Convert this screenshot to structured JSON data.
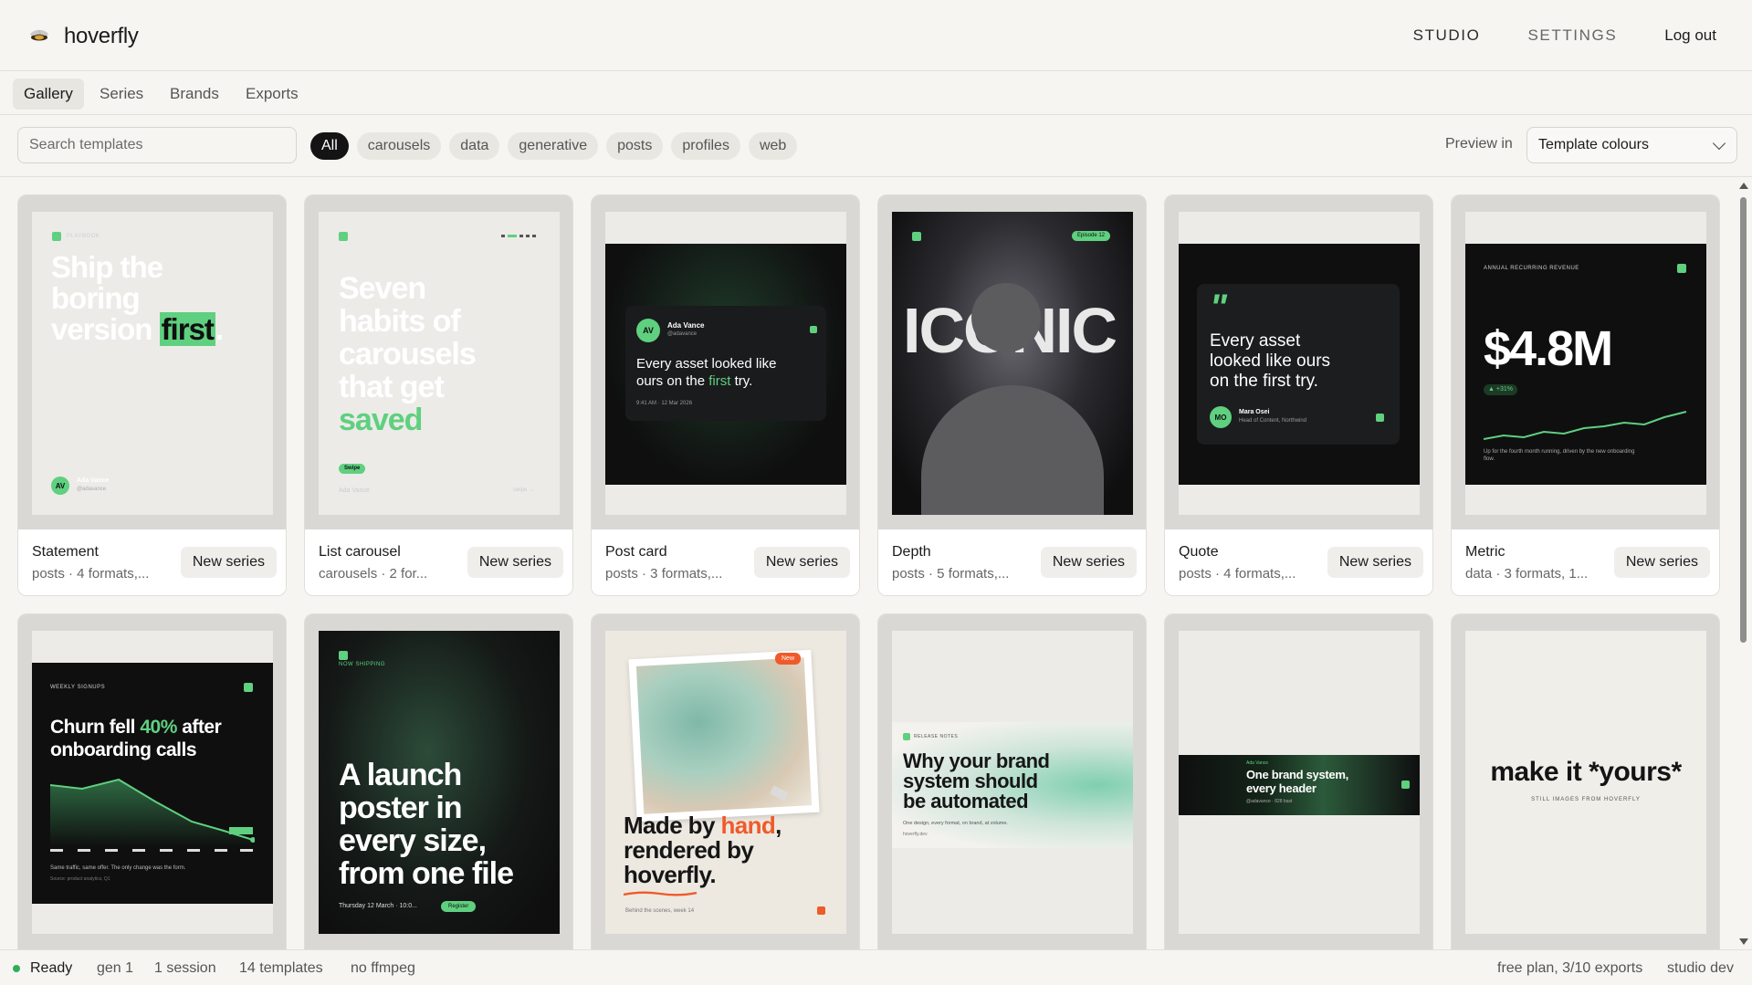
{
  "app": {
    "name": "hoverfly"
  },
  "topnav": {
    "studio": "STUDIO",
    "settings": "SETTINGS",
    "logout": "Log out"
  },
  "tabs": [
    "Gallery",
    "Series",
    "Brands",
    "Exports"
  ],
  "search": {
    "placeholder": "Search templates",
    "value": ""
  },
  "filters": [
    "All",
    "carousels",
    "data",
    "generative",
    "posts",
    "profiles",
    "web"
  ],
  "preview": {
    "label": "Preview in",
    "selected": "Template colours"
  },
  "cards": [
    {
      "name": "Statement",
      "desc": "posts · 4 formats,...",
      "button": "New series"
    },
    {
      "name": "List carousel",
      "desc": "carousels · 2 for...",
      "button": "New series"
    },
    {
      "name": "Post card",
      "desc": "posts · 3 formats,...",
      "button": "New series"
    },
    {
      "name": "Depth",
      "desc": "posts · 5 formats,...",
      "button": "New series"
    },
    {
      "name": "Quote",
      "desc": "posts · 4 formats,...",
      "button": "New series"
    },
    {
      "name": "Metric",
      "desc": "data · 3 formats, 1...",
      "button": "New series"
    }
  ],
  "thumbs": {
    "statement": {
      "kicker": "PLAYBOOK",
      "line1": "Ship the",
      "line2": "boring",
      "line3": "version",
      "accent": "first",
      "end": ".",
      "avatar": "AV",
      "author": "Ada Vance",
      "handle": "@adavance"
    },
    "list": {
      "line1": "Seven",
      "line2": "habits of",
      "line3": "carousels",
      "line4": "that get",
      "accent": "saved",
      "pill": "Swipe",
      "author": "Ada Vance",
      "swipe": "swipe →"
    },
    "postcard": {
      "avatar": "AV",
      "author": "Ada Vance",
      "handle": "@adavance",
      "text1": "Every asset looked like",
      "text2": "ours on the",
      "accent": "first",
      "text3": "try.",
      "time": "9:41 AM · 12 Mar 2026"
    },
    "depth": {
      "word": "ICONIC",
      "badge": "Episode 12"
    },
    "quote": {
      "mark": "\"",
      "line1": "Every asset",
      "line2": "looked like ours",
      "line3": "on the first try.",
      "avatar": "MO",
      "author": "Mara Osei",
      "role": "Head of Content, Northwind"
    },
    "metric": {
      "kicker": "ANNUAL RECURRING REVENUE",
      "value": "$4.8M",
      "delta": "▲ +31%",
      "caption": "Up for the fourth month running, driven by the new onboarding flow."
    },
    "churn": {
      "kicker": "WEEKLY SIGNUPS",
      "line1a": "Churn fell",
      "accent": "40%",
      "line1b": "after",
      "line2": "onboarding calls",
      "caption": "Same traffic, same offer. The only change was the form.",
      "source": "Source: product analytics, Q1"
    },
    "launch": {
      "kicker": "NOW SHIPPING",
      "line1": "A launch",
      "line2": "poster in",
      "line3": "every size,",
      "line4": "from one file",
      "date": "Thursday 12 March · 10:0...",
      "pill": "Register"
    },
    "hand": {
      "badge": "New",
      "line1a": "Made by",
      "accent": "hand",
      "line1b": ",",
      "line2": "rendered by",
      "line3": "hoverfly.",
      "caption": "Behind the scenes, week 14"
    },
    "blog": {
      "kicker": "RELEASE NOTES",
      "line1": "Why your brand",
      "line2": "system should",
      "line3": "be automated",
      "caption": "One design, every format, on brand, at volume.",
      "site": "hoverfly.dev"
    },
    "header": {
      "author": "Ada Vance",
      "line1": "One brand system,",
      "line2": "every header",
      "meta": "@adavance · 828 bast"
    },
    "yours": {
      "title": "make it *yours*",
      "sub": "STILL IMAGES FROM HOVERFLY"
    }
  },
  "status": {
    "state": "Ready",
    "gen": "gen 1",
    "sessions": "1 session",
    "templates": "14 templates",
    "ffmpeg": "no ffmpeg",
    "plan": "free plan, 3/10 exports",
    "env": "studio dev"
  },
  "colors": {
    "accent": "#5fd07f",
    "dark": "#0f0f10",
    "orange": "#f05a2a",
    "ready": "#2fae5a"
  }
}
